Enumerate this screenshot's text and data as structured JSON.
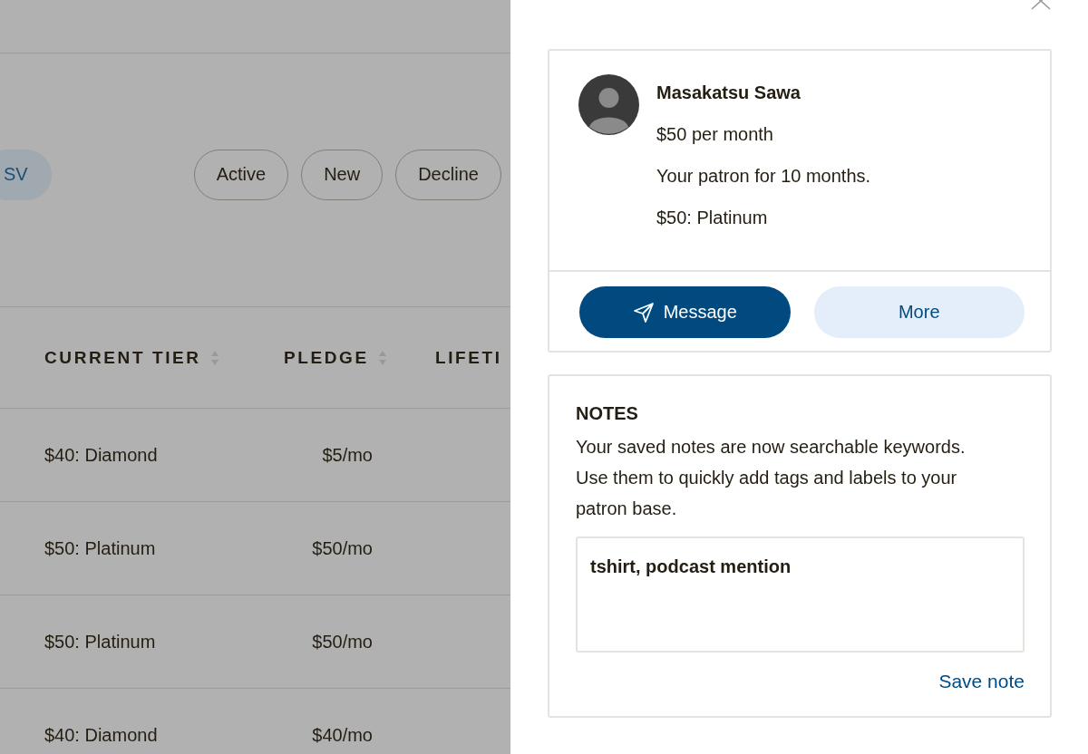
{
  "toolbar": {
    "export_button": "SV",
    "filters": [
      {
        "label": "Active"
      },
      {
        "label": "New"
      },
      {
        "label": "Decline"
      }
    ]
  },
  "table": {
    "columns": [
      {
        "label": "CURRENT TIER",
        "sortable": true
      },
      {
        "label": "PLEDGE",
        "sortable": true
      },
      {
        "label": "LIFETI"
      }
    ],
    "rows": [
      [
        "$40: Diamond",
        "$5/mo"
      ],
      [
        "$50: Platinum",
        "$50/mo"
      ],
      [
        "$50: Platinum",
        "$50/mo"
      ],
      [
        "$40: Diamond",
        "$40/mo"
      ]
    ]
  },
  "drawer": {
    "patron": {
      "name": "Masakatsu Sawa",
      "pledge": "$50 per month",
      "duration": "Your patron for 10 months.",
      "tier": "$50: Platinum"
    },
    "actions": [
      {
        "label": "Message",
        "kind": "primary"
      },
      {
        "label": "More",
        "kind": "secondary"
      }
    ],
    "notes": {
      "title": "NOTES",
      "description": "Your saved notes are now searchable keywords. Use them to quickly add tags and labels to your patron base.",
      "value": "tshirt, podcast mention",
      "save_label": "Save note"
    }
  }
}
